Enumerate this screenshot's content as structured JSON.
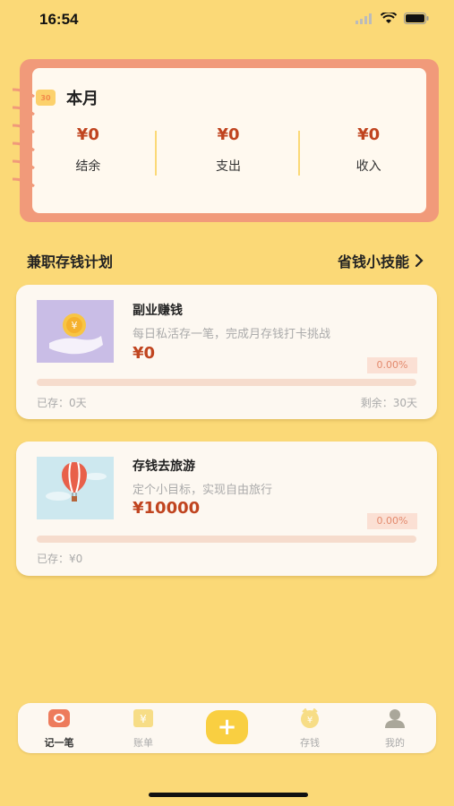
{
  "status_bar": {
    "time": "16:54"
  },
  "summary": {
    "calendar_icon_text": "30",
    "title": "本月",
    "stats": [
      {
        "value": "¥0",
        "label": "结余"
      },
      {
        "value": "¥0",
        "label": "支出"
      },
      {
        "value": "¥0",
        "label": "收入"
      }
    ]
  },
  "section": {
    "title": "兼职存钱计划",
    "link": "省钱小技能"
  },
  "plans": [
    {
      "name": "副业赚钱",
      "desc": "每日私活存一笔，完成月存钱打卡挑战",
      "amount": "¥0",
      "percent": "0.00%",
      "progress": 0,
      "saved": "已存：0天",
      "remaining": "剩余：30天",
      "icon": "coin-hand-icon"
    },
    {
      "name": "存钱去旅游",
      "desc": "定个小目标，实现自由旅行",
      "amount": "¥10000",
      "percent": "0.00%",
      "progress": 0,
      "saved": "已存：¥0",
      "icon": "hot-air-balloon-icon"
    }
  ],
  "tabbar": {
    "tabs": [
      {
        "label": "记一笔",
        "icon": "notebook-icon"
      },
      {
        "label": "账单",
        "icon": "bill-icon"
      },
      {
        "label": "存钱",
        "icon": "piggy-bank-icon"
      },
      {
        "label": "我的",
        "icon": "user-icon"
      }
    ],
    "add": "+"
  },
  "colors": {
    "background": "#fbd977",
    "accent": "#c0441f",
    "card_border": "#f19a7a",
    "add_button": "#f9cf41"
  }
}
